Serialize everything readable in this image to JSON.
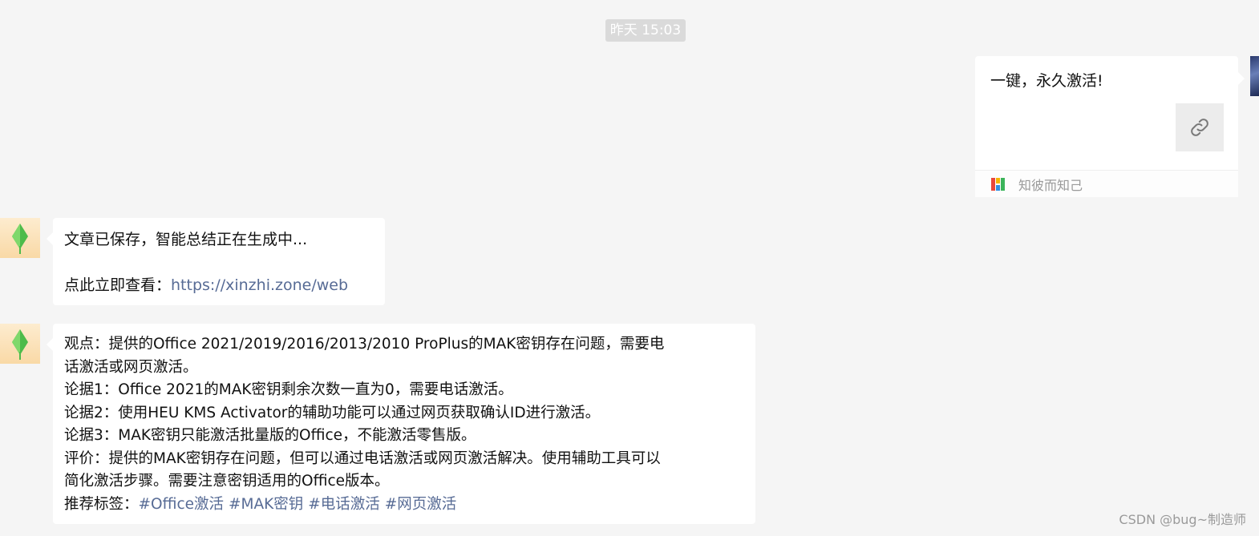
{
  "timestamp": "昨天 15:03",
  "outgoing_card": {
    "title": "一键，永久激活!",
    "source": "知彼而知己",
    "thumb_icon": "link-icon"
  },
  "message1": {
    "line1": "文章已保存，智能总结正在生成中...",
    "line2_prefix": "点此立即查看：",
    "link": "https://xinzhi.zone/web"
  },
  "message2": {
    "lines": [
      "观点：提供的Office 2021/2019/2016/2013/2010 ProPlus的MAK密钥存在问题，需要电",
      "话激活或网页激活。",
      "论据1：Office 2021的MAK密钥剩余次数一直为0，需要电话激活。",
      "论据2：使用HEU KMS Activator的辅助功能可以通过网页获取确认ID进行激活。",
      "论据3：MAK密钥只能激活批量版的Office，不能激活零售版。",
      "评价：提供的MAK密钥存在问题，但可以通过电话激活或网页激活解决。使用辅助工具可以",
      "简化激活步骤。需要注意密钥适用的Office版本。"
    ],
    "tags_label": "推荐标签：",
    "tags": [
      "#Office激活",
      "#MAK密钥",
      "#电话激活",
      "#网页激活"
    ]
  },
  "watermark": "CSDN @bug~制造师",
  "colors": {
    "background": "#f5f5f5",
    "link": "#576b95",
    "bubble": "#ffffff"
  }
}
